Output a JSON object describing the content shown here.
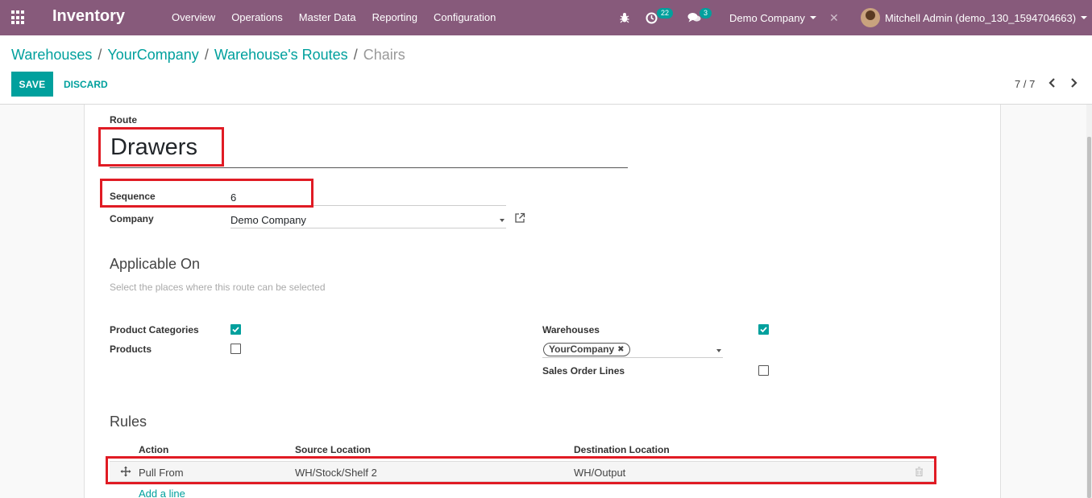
{
  "navbar": {
    "brand": "Inventory",
    "menu": [
      "Overview",
      "Operations",
      "Master Data",
      "Reporting",
      "Configuration"
    ],
    "activity_count": "22",
    "message_count": "3",
    "company": "Demo Company",
    "user": "Mitchell Admin (demo_130_1594704663)"
  },
  "breadcrumb": {
    "items": [
      "Warehouses",
      "YourCompany",
      "Warehouse's Routes"
    ],
    "current": "Chairs",
    "separator": "/"
  },
  "buttons": {
    "save": "SAVE",
    "discard": "DISCARD"
  },
  "pager": {
    "value": "7 / 7"
  },
  "form": {
    "route_label": "Route",
    "route_name": "Drawers",
    "sequence_label": "Sequence",
    "sequence_value": "6",
    "company_label": "Company",
    "company_value": "Demo Company",
    "applicable_title": "Applicable On",
    "applicable_help": "Select the places where this route can be selected",
    "product_categories_label": "Product Categories",
    "product_categories_checked": true,
    "products_label": "Products",
    "products_checked": false,
    "warehouses_label": "Warehouses",
    "warehouses_checked": true,
    "warehouse_tag": "YourCompany",
    "sales_order_lines_label": "Sales Order Lines",
    "sales_order_lines_checked": false,
    "rules_title": "Rules",
    "rules_columns": [
      "Action",
      "Source Location",
      "Destination Location"
    ],
    "rules_rows": [
      {
        "action": "Pull From",
        "source": "WH/Stock/Shelf 2",
        "destination": "WH/Output"
      }
    ],
    "add_line": "Add a line"
  },
  "colors": {
    "navbar": "#875a7b",
    "accent": "#00a09d",
    "highlight": "#e01b24"
  }
}
